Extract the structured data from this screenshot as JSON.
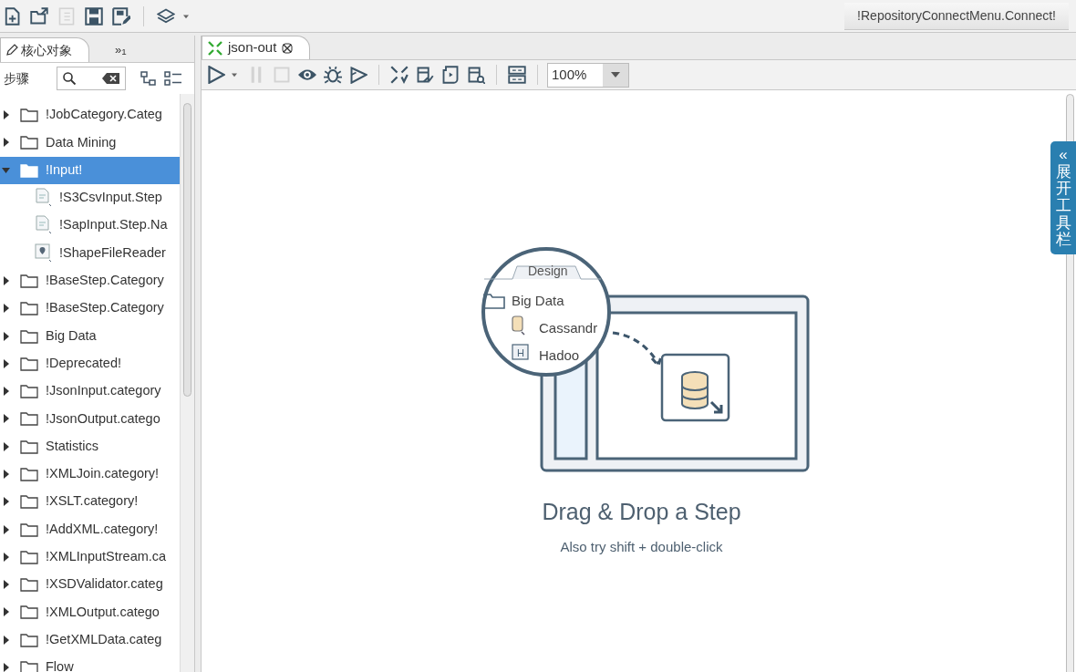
{
  "main_toolbar": [
    {
      "kind": "new-file",
      "disabled": false
    },
    {
      "kind": "open",
      "disabled": false
    },
    {
      "kind": "document",
      "disabled": true
    },
    {
      "kind": "save",
      "disabled": false
    },
    {
      "kind": "save-as",
      "disabled": false
    },
    {
      "kind": "separator"
    },
    {
      "kind": "layers",
      "disabled": false
    },
    {
      "kind": "caret"
    }
  ],
  "connect_button": "!RepositoryConnectMenu.Connect!",
  "left_tabs": [
    {
      "label": "核心对象",
      "selected": true,
      "kind": "pencil"
    },
    {
      "label": "»",
      "sub": "1",
      "selected": false,
      "kind": "overflow"
    }
  ],
  "steps_label": "步骤",
  "tree": [
    {
      "label": "!JobCategory.Categ",
      "kind": "folder",
      "expanded": false,
      "selected": false
    },
    {
      "label": "Data Mining",
      "kind": "folder",
      "expanded": false,
      "selected": false
    },
    {
      "label": "!Input!",
      "kind": "folder",
      "expanded": true,
      "selected": true,
      "children": [
        {
          "label": "!S3CsvInput.Step",
          "kind": "step",
          "selected": false
        },
        {
          "label": "!SapInput.Step.Na",
          "kind": "step",
          "selected": false
        },
        {
          "label": "!ShapeFileReader",
          "kind": "map-step",
          "selected": false
        }
      ]
    },
    {
      "label": "!BaseStep.Category",
      "kind": "folder",
      "expanded": false,
      "selected": false
    },
    {
      "label": "!BaseStep.Category",
      "kind": "folder",
      "expanded": false,
      "selected": false
    },
    {
      "label": "Big Data",
      "kind": "folder",
      "expanded": false,
      "selected": false
    },
    {
      "label": "!Deprecated!",
      "kind": "folder",
      "expanded": false,
      "selected": false
    },
    {
      "label": "!JsonInput.category",
      "kind": "folder",
      "expanded": false,
      "selected": false
    },
    {
      "label": "!JsonOutput.catego",
      "kind": "folder",
      "expanded": false,
      "selected": false
    },
    {
      "label": "Statistics",
      "kind": "folder",
      "expanded": false,
      "selected": false
    },
    {
      "label": "!XMLJoin.category!",
      "kind": "folder",
      "expanded": false,
      "selected": false
    },
    {
      "label": "!XSLT.category!",
      "kind": "folder",
      "expanded": false,
      "selected": false
    },
    {
      "label": "!AddXML.category!",
      "kind": "folder",
      "expanded": false,
      "selected": false
    },
    {
      "label": "!XMLInputStream.ca",
      "kind": "folder",
      "expanded": false,
      "selected": false
    },
    {
      "label": "!XSDValidator.categ",
      "kind": "folder",
      "expanded": false,
      "selected": false
    },
    {
      "label": "!XMLOutput.catego",
      "kind": "folder",
      "expanded": false,
      "selected": false
    },
    {
      "label": "!GetXMLData.categ",
      "kind": "folder",
      "expanded": false,
      "selected": false
    },
    {
      "label": "Flow",
      "kind": "folder",
      "expanded": false,
      "selected": false
    }
  ],
  "editor_tab": {
    "label": "json-out",
    "selected": true
  },
  "editor_toolbar": [
    {
      "kind": "run",
      "disabled": false
    },
    {
      "kind": "caret"
    },
    {
      "kind": "pause",
      "disabled": true
    },
    {
      "kind": "stop",
      "disabled": true
    },
    {
      "kind": "eye",
      "disabled": false
    },
    {
      "kind": "bug",
      "disabled": false
    },
    {
      "kind": "replay",
      "disabled": false
    },
    {
      "kind": "separator"
    },
    {
      "kind": "verify",
      "disabled": false
    },
    {
      "kind": "analyze",
      "disabled": false
    },
    {
      "kind": "script",
      "disabled": false
    },
    {
      "kind": "db-search",
      "disabled": false
    },
    {
      "kind": "separator"
    },
    {
      "kind": "grid",
      "disabled": false
    },
    {
      "kind": "separator"
    }
  ],
  "zoom": "100%",
  "canvas": {
    "design_tab": "Design",
    "folder": "Big Data",
    "step_1": "Cassandr",
    "step_2": "Hadoo",
    "step_2_badge": "H",
    "title": "Drag & Drop a Step",
    "hint": "Also try shift + double-click"
  },
  "side_tab": {
    "arrow": "«",
    "label": "展开工具栏"
  }
}
